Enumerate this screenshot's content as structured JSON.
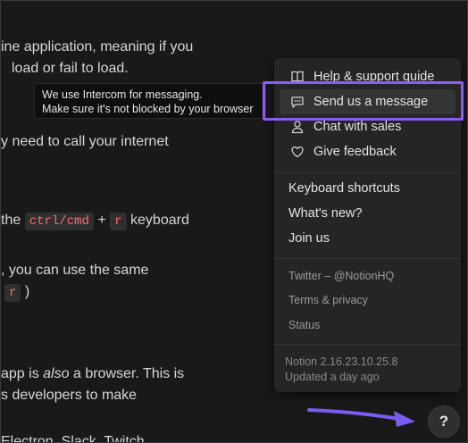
{
  "document": {
    "line1": "ine application, meaning if you",
    "line2": "load or fail to load.",
    "line3": "y need to call your internet",
    "line4_pre": "the",
    "line4_code1": "ctrl/cmd",
    "line4_plus": "+",
    "line4_code2": "r",
    "line4_post": "keyboard",
    "line5": ", you can use the same",
    "line6_code": "r",
    "line6_post": ")",
    "line7_pre": "app is",
    "line7_em": "also",
    "line7_post": "a browser. This is",
    "line8": "s developers to make",
    "line9": "Electron, Slack, Twitch"
  },
  "tooltip": {
    "line1": "We use Intercom for messaging.",
    "line2": "Make sure it's not blocked by your browser"
  },
  "menu": {
    "help_support": "Help & support guide",
    "send_message": "Send us a message",
    "chat_sales": "Chat with sales",
    "give_feedback": "Give feedback",
    "keyboard_shortcuts": "Keyboard shortcuts",
    "whats_new": "What's new?",
    "join_us": "Join us",
    "twitter": "Twitter – @NotionHQ",
    "terms": "Terms & privacy",
    "status": "Status",
    "version": "Notion 2.16.23.10.25.8",
    "updated": "Updated a day ago"
  },
  "help_button": {
    "label": "?"
  },
  "icons": {
    "help_support": "book-icon",
    "send_message": "chat-bubble-icon",
    "chat_sales": "person-icon",
    "give_feedback": "heart-icon"
  },
  "colors": {
    "accent_highlight": "#8b5cf6",
    "code_text": "#ff6b6b",
    "background": "#191919",
    "menu_background": "#252525"
  }
}
